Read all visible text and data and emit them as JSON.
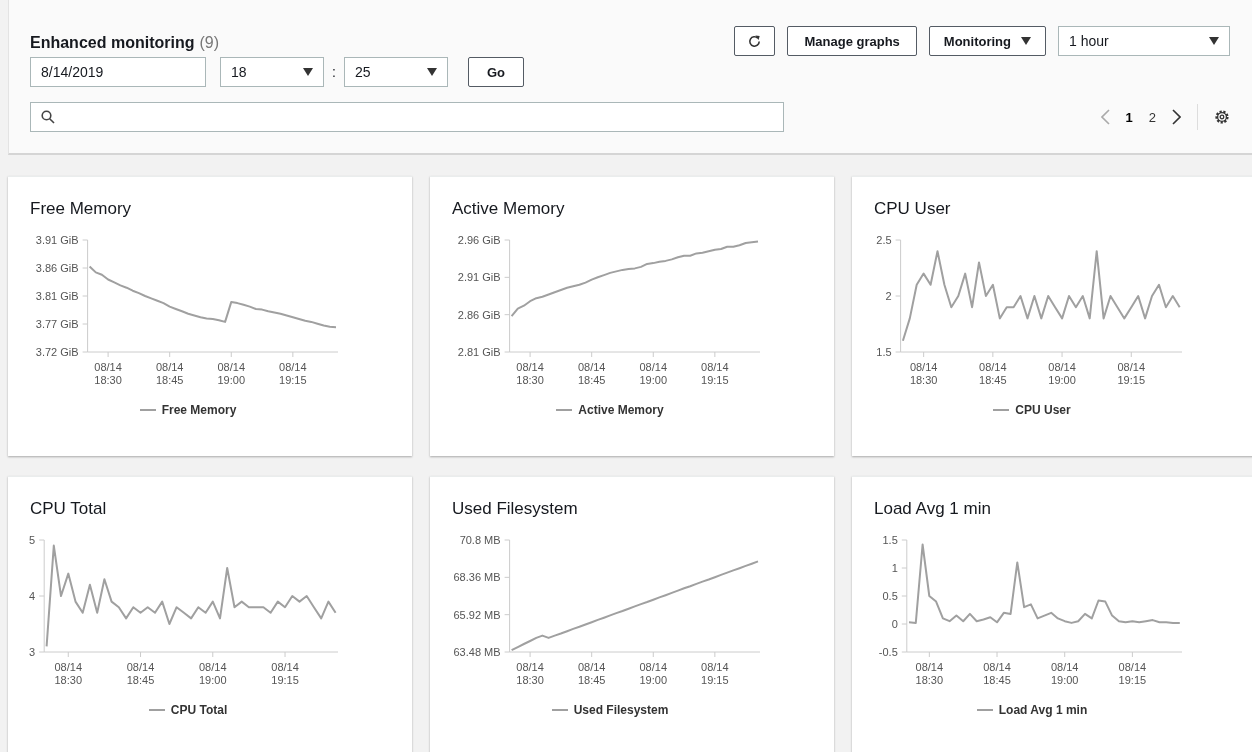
{
  "header": {
    "title": "Enhanced monitoring",
    "count": "(9)",
    "date": {
      "value": "8/14/2019"
    },
    "hour": {
      "value": "18"
    },
    "separator": ":",
    "minute": {
      "value": "25"
    },
    "go_button": "Go",
    "manage_button": "Manage graphs",
    "monitoring_menu": "Monitoring",
    "range_select": {
      "value": "1 hour"
    },
    "pages": [
      {
        "label": "1",
        "selected": true
      },
      {
        "label": "2",
        "selected": false
      }
    ]
  },
  "graphs": [
    {
      "title": "Free Memory",
      "chart_data": {
        "type": "line",
        "categories": [
          null,
          null,
          null,
          "08/14 18:30",
          null,
          null,
          null,
          null,
          null,
          null,
          null,
          null,
          null,
          "08/14 18:45",
          null,
          null,
          null,
          null,
          null,
          null,
          null,
          null,
          null,
          "08/14 19:00",
          null,
          null,
          null,
          null,
          null,
          null,
          null,
          null,
          null,
          "08/14 19:15",
          null,
          null,
          null,
          null,
          null,
          null,
          null
        ],
        "ylim": [
          3.72,
          3.91
        ],
        "yticks": [
          {
            "value": 3.72,
            "label": "3.72 GiB"
          },
          {
            "value": 3.7675,
            "label": "3.77 GiB"
          },
          {
            "value": 3.815,
            "label": "3.81 GiB"
          },
          {
            "value": 3.8625,
            "label": "3.86 GiB"
          },
          {
            "value": 3.91,
            "label": "3.91 GiB"
          }
        ],
        "series": [
          {
            "name": "Free Memory",
            "color": "#a0a0a0",
            "values": [
              3.865,
              3.855,
              3.851,
              3.843,
              3.838,
              3.833,
              3.829,
              3.824,
              3.82,
              3.815,
              3.811,
              3.807,
              3.803,
              3.797,
              3.793,
              3.789,
              3.785,
              3.782,
              3.779,
              3.777,
              3.776,
              3.774,
              3.771,
              3.805,
              3.803,
              3.8,
              3.797,
              3.793,
              3.792,
              3.789,
              3.787,
              3.785,
              3.782,
              3.779,
              3.776,
              3.773,
              3.771,
              3.768,
              3.765,
              3.763,
              3.762
            ]
          }
        ]
      }
    },
    {
      "title": "Active Memory",
      "chart_data": {
        "type": "line",
        "categories": [
          null,
          null,
          null,
          "08/14 18:30",
          null,
          null,
          null,
          null,
          null,
          null,
          null,
          null,
          null,
          "08/14 18:45",
          null,
          null,
          null,
          null,
          null,
          null,
          null,
          null,
          null,
          "08/14 19:00",
          null,
          null,
          null,
          null,
          null,
          null,
          null,
          null,
          null,
          "08/14 19:15",
          null,
          null,
          null,
          null,
          null,
          null,
          null
        ],
        "ylim": [
          2.81,
          2.96
        ],
        "yticks": [
          {
            "value": 2.81,
            "label": "2.81 GiB"
          },
          {
            "value": 2.86,
            "label": "2.86 GiB"
          },
          {
            "value": 2.91,
            "label": "2.91 GiB"
          },
          {
            "value": 2.96,
            "label": "2.96 GiB"
          }
        ],
        "series": [
          {
            "name": "Active Memory",
            "color": "#a0a0a0",
            "values": [
              2.858,
              2.868,
              2.872,
              2.878,
              2.882,
              2.884,
              2.887,
              2.89,
              2.893,
              2.896,
              2.898,
              2.9,
              2.903,
              2.907,
              2.91,
              2.913,
              2.916,
              2.918,
              2.92,
              2.921,
              2.922,
              2.924,
              2.928,
              2.929,
              2.931,
              2.932,
              2.934,
              2.937,
              2.939,
              2.939,
              2.942,
              2.943,
              2.945,
              2.947,
              2.948,
              2.951,
              2.951,
              2.953,
              2.956,
              2.957,
              2.958
            ]
          }
        ]
      }
    },
    {
      "title": "CPU User",
      "chart_data": {
        "type": "line",
        "categories": [
          null,
          null,
          null,
          "08/14 18:30",
          null,
          null,
          null,
          null,
          null,
          null,
          null,
          null,
          null,
          "08/14 18:45",
          null,
          null,
          null,
          null,
          null,
          null,
          null,
          null,
          null,
          "08/14 19:00",
          null,
          null,
          null,
          null,
          null,
          null,
          null,
          null,
          null,
          "08/14 19:15",
          null,
          null,
          null,
          null,
          null,
          null,
          null
        ],
        "ylim": [
          1.5,
          2.5
        ],
        "yticks": [
          {
            "value": 1.5,
            "label": "1.5"
          },
          {
            "value": 2,
            "label": "2"
          },
          {
            "value": 2.5,
            "label": "2.5"
          }
        ],
        "series": [
          {
            "name": "CPU User",
            "color": "#a0a0a0",
            "values": [
              1.6,
              1.8,
              2.1,
              2.2,
              2.1,
              2.4,
              2.1,
              1.9,
              2.0,
              2.2,
              1.9,
              2.3,
              2.0,
              2.1,
              1.8,
              1.9,
              1.9,
              2.0,
              1.8,
              2.0,
              1.8,
              2.0,
              1.9,
              1.8,
              2.0,
              1.9,
              2.0,
              1.8,
              2.4,
              1.8,
              2.0,
              1.9,
              1.8,
              1.9,
              2.0,
              1.8,
              2.0,
              2.1,
              1.9,
              2.0,
              1.9
            ]
          }
        ]
      }
    },
    {
      "title": "CPU Total",
      "chart_data": {
        "type": "line",
        "categories": [
          null,
          null,
          null,
          "08/14 18:30",
          null,
          null,
          null,
          null,
          null,
          null,
          null,
          null,
          null,
          "08/14 18:45",
          null,
          null,
          null,
          null,
          null,
          null,
          null,
          null,
          null,
          "08/14 19:00",
          null,
          null,
          null,
          null,
          null,
          null,
          null,
          null,
          null,
          "08/14 19:15",
          null,
          null,
          null,
          null,
          null,
          null,
          null
        ],
        "ylim": [
          3,
          5
        ],
        "yticks": [
          {
            "value": 3,
            "label": "3"
          },
          {
            "value": 4,
            "label": "4"
          },
          {
            "value": 5,
            "label": "5"
          }
        ],
        "series": [
          {
            "name": "CPU Total",
            "color": "#a0a0a0",
            "values": [
              3.1,
              4.9,
              4.0,
              4.4,
              3.9,
              3.7,
              4.2,
              3.7,
              4.3,
              3.9,
              3.8,
              3.6,
              3.8,
              3.7,
              3.8,
              3.7,
              3.9,
              3.5,
              3.8,
              3.7,
              3.6,
              3.8,
              3.7,
              3.9,
              3.6,
              4.5,
              3.8,
              3.9,
              3.8,
              3.8,
              3.8,
              3.7,
              3.9,
              3.8,
              4.0,
              3.9,
              4.0,
              3.8,
              3.6,
              3.9,
              3.7
            ]
          }
        ]
      }
    },
    {
      "title": "Used Filesystem",
      "chart_data": {
        "type": "line",
        "categories": [
          null,
          null,
          null,
          "08/14 18:30",
          null,
          null,
          null,
          null,
          null,
          null,
          null,
          null,
          null,
          "08/14 18:45",
          null,
          null,
          null,
          null,
          null,
          null,
          null,
          null,
          null,
          "08/14 19:00",
          null,
          null,
          null,
          null,
          null,
          null,
          null,
          null,
          null,
          "08/14 19:15",
          null,
          null,
          null,
          null,
          null,
          null,
          null
        ],
        "ylim": [
          63.48,
          70.8
        ],
        "yticks": [
          {
            "value": 63.48,
            "label": "63.48 MB"
          },
          {
            "value": 65.92,
            "label": "65.92 MB"
          },
          {
            "value": 68.36,
            "label": "68.36 MB"
          },
          {
            "value": 70.8,
            "label": "70.8 MB"
          }
        ],
        "series": [
          {
            "name": "Used Filesystem",
            "color": "#a0a0a0",
            "values": [
              63.6,
              63.8,
              64.0,
              64.2,
              64.4,
              64.55,
              64.4,
              64.55,
              64.69,
              64.84,
              64.99,
              65.13,
              65.28,
              65.43,
              65.58,
              65.72,
              65.87,
              66.02,
              66.16,
              66.31,
              66.46,
              66.61,
              66.75,
              66.9,
              67.05,
              67.19,
              67.34,
              67.49,
              67.64,
              67.78,
              67.93,
              68.08,
              68.22,
              68.37,
              68.52,
              68.67,
              68.81,
              68.96,
              69.11,
              69.25,
              69.4
            ]
          }
        ]
      }
    },
    {
      "title": "Load Avg 1 min",
      "chart_data": {
        "type": "line",
        "categories": [
          null,
          null,
          null,
          "08/14 18:30",
          null,
          null,
          null,
          null,
          null,
          null,
          null,
          null,
          null,
          "08/14 18:45",
          null,
          null,
          null,
          null,
          null,
          null,
          null,
          null,
          null,
          "08/14 19:00",
          null,
          null,
          null,
          null,
          null,
          null,
          null,
          null,
          null,
          "08/14 19:15",
          null,
          null,
          null,
          null,
          null,
          null,
          null
        ],
        "ylim": [
          -0.5,
          1.5
        ],
        "yticks": [
          {
            "value": -0.5,
            "label": "-0.5"
          },
          {
            "value": 0,
            "label": "0"
          },
          {
            "value": 0.5,
            "label": "0.5"
          },
          {
            "value": 1,
            "label": "1"
          },
          {
            "value": 1.5,
            "label": "1.5"
          }
        ],
        "series": [
          {
            "name": "Load Avg 1 min",
            "color": "#a0a0a0",
            "values": [
              0.03,
              0.02,
              1.42,
              0.5,
              0.4,
              0.1,
              0.05,
              0.15,
              0.05,
              0.18,
              0.05,
              0.08,
              0.12,
              0.03,
              0.2,
              0.18,
              1.1,
              0.3,
              0.35,
              0.1,
              0.15,
              0.2,
              0.1,
              0.05,
              0.02,
              0.05,
              0.18,
              0.1,
              0.42,
              0.4,
              0.15,
              0.05,
              0.03,
              0.05,
              0.03,
              0.05,
              0.07,
              0.03,
              0.03,
              0.02,
              0.02
            ]
          }
        ]
      }
    }
  ]
}
